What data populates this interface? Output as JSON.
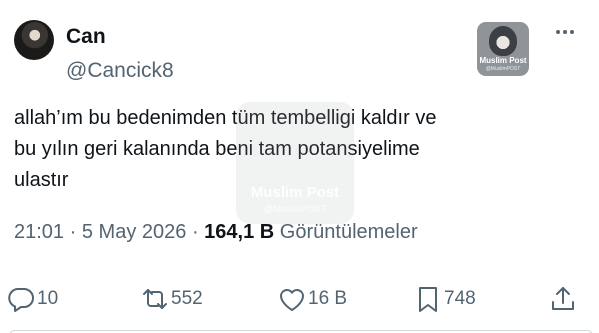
{
  "author": {
    "display_name": "Can",
    "handle": "@Cancick8",
    "avatar_icon": "user-avatar"
  },
  "watermark": {
    "brand": "Muslim Post",
    "sub": "@MuslimPOST"
  },
  "tweet": {
    "text": "allah’ım bu bedenimden tüm tembelligi kaldır ve\nbu yılın geri kalanında beni tam potansiyelime\nulastır"
  },
  "meta": {
    "time": "21:01",
    "separator": "·",
    "date": "5 May 2026",
    "views_count": "164,1 B",
    "views_label": "Görüntülemeler"
  },
  "actions": {
    "replies": "10",
    "reposts": "552",
    "likes": "16 B",
    "bookmarks": "748"
  },
  "colors": {
    "text": "#0f1419",
    "secondary": "#536471",
    "background": "#ffffff"
  }
}
